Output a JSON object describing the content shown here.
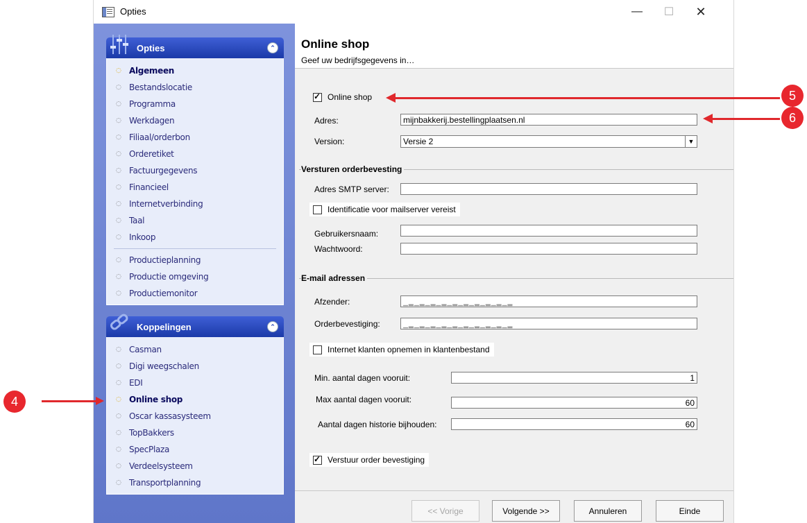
{
  "window": {
    "title": "Opties",
    "minimize": "—",
    "maximize": "☐",
    "close": "✕"
  },
  "sidebar": {
    "opties": {
      "title": "Opties",
      "collapse": "⌃",
      "items": [
        {
          "label": "Algemeen"
        },
        {
          "label": "Bestandslocatie"
        },
        {
          "label": "Programma"
        },
        {
          "label": "Werkdagen"
        },
        {
          "label": "Filiaal/orderbon"
        },
        {
          "label": "Orderetiket"
        },
        {
          "label": "Factuurgegevens"
        },
        {
          "label": "Financieel"
        },
        {
          "label": "Internetverbinding"
        },
        {
          "label": "Taal"
        },
        {
          "label": "Inkoop"
        },
        {
          "label": "Productieplanning"
        },
        {
          "label": "Productie omgeving"
        },
        {
          "label": "Productiemonitor"
        }
      ]
    },
    "koppelingen": {
      "title": "Koppelingen",
      "collapse": "⌃",
      "items": [
        {
          "label": "Casman"
        },
        {
          "label": "Digi weegschalen"
        },
        {
          "label": "EDI"
        },
        {
          "label": "Online shop"
        },
        {
          "label": "Oscar kassasysteem"
        },
        {
          "label": "TopBakkers"
        },
        {
          "label": "SpecPlaza"
        },
        {
          "label": "Verdeelsysteem"
        },
        {
          "label": "Transportplanning"
        }
      ]
    }
  },
  "content": {
    "title": "Online shop",
    "subtitle": "Geef uw bedrijfsgegevens in…",
    "online_shop_label": "Online shop",
    "adres_label": "Adres:",
    "adres_value": "mijnbakkerij.bestellingplaatsen.nl",
    "version_label": "Version:",
    "version_value": "Versie 2",
    "group_versturen": "Versturen orderbevesting",
    "smtp_label": "Adres SMTP server:",
    "smtp_value": "",
    "ident_label": "Identificatie voor mailserver vereist",
    "user_label": "Gebruikersnaam:",
    "user_value": "",
    "pass_label": "Wachtwoord:",
    "pass_value": "",
    "group_email": "E-mail adressen",
    "afzender_label": "Afzender:",
    "orderbev_label": "Orderbevestiging:",
    "internet_klanten_label": "Internet klanten opnemen in klantenbestand",
    "min_dagen_label": "Min. aantal dagen vooruit:",
    "min_dagen_value": "1",
    "max_dagen_label": "Max aantal dagen vooruit:",
    "max_dagen_value": "60",
    "historie_label": "Aantal dagen historie bijhouden:",
    "historie_value": "60",
    "verstuur_label": "Verstuur order bevestiging"
  },
  "buttons": {
    "vorige": "<< Vorige",
    "volgende": "Volgende >>",
    "annuleren": "Annuleren",
    "einde": "Einde"
  },
  "annotations": {
    "badge_4": "4",
    "badge_5": "5",
    "badge_6": "6"
  },
  "colors": {
    "sidebar": "#6a80d0",
    "panel_header": "#1b3aa8",
    "annotation_red": "#e0282c"
  }
}
